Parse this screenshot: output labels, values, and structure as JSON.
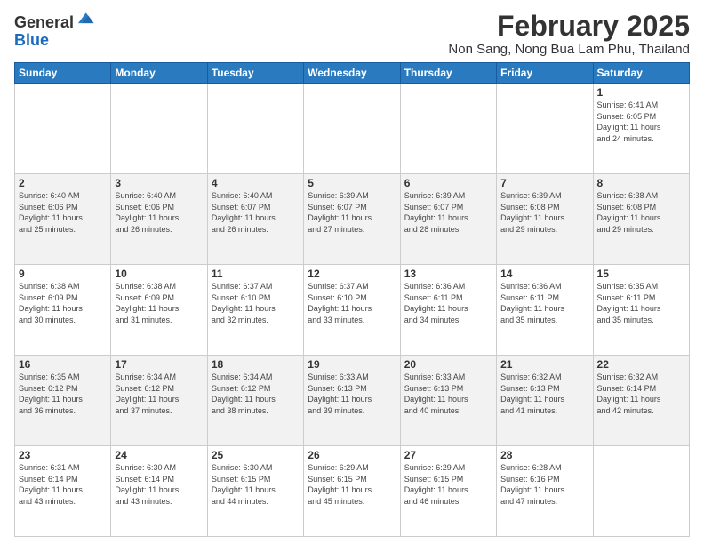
{
  "logo": {
    "general": "General",
    "blue": "Blue"
  },
  "header": {
    "month": "February 2025",
    "location": "Non Sang, Nong Bua Lam Phu, Thailand"
  },
  "weekdays": [
    "Sunday",
    "Monday",
    "Tuesday",
    "Wednesday",
    "Thursday",
    "Friday",
    "Saturday"
  ],
  "weeks": [
    [
      {
        "day": "",
        "info": ""
      },
      {
        "day": "",
        "info": ""
      },
      {
        "day": "",
        "info": ""
      },
      {
        "day": "",
        "info": ""
      },
      {
        "day": "",
        "info": ""
      },
      {
        "day": "",
        "info": ""
      },
      {
        "day": "1",
        "info": "Sunrise: 6:41 AM\nSunset: 6:05 PM\nDaylight: 11 hours\nand 24 minutes."
      }
    ],
    [
      {
        "day": "2",
        "info": "Sunrise: 6:40 AM\nSunset: 6:06 PM\nDaylight: 11 hours\nand 25 minutes."
      },
      {
        "day": "3",
        "info": "Sunrise: 6:40 AM\nSunset: 6:06 PM\nDaylight: 11 hours\nand 26 minutes."
      },
      {
        "day": "4",
        "info": "Sunrise: 6:40 AM\nSunset: 6:07 PM\nDaylight: 11 hours\nand 26 minutes."
      },
      {
        "day": "5",
        "info": "Sunrise: 6:39 AM\nSunset: 6:07 PM\nDaylight: 11 hours\nand 27 minutes."
      },
      {
        "day": "6",
        "info": "Sunrise: 6:39 AM\nSunset: 6:07 PM\nDaylight: 11 hours\nand 28 minutes."
      },
      {
        "day": "7",
        "info": "Sunrise: 6:39 AM\nSunset: 6:08 PM\nDaylight: 11 hours\nand 29 minutes."
      },
      {
        "day": "8",
        "info": "Sunrise: 6:38 AM\nSunset: 6:08 PM\nDaylight: 11 hours\nand 29 minutes."
      }
    ],
    [
      {
        "day": "9",
        "info": "Sunrise: 6:38 AM\nSunset: 6:09 PM\nDaylight: 11 hours\nand 30 minutes."
      },
      {
        "day": "10",
        "info": "Sunrise: 6:38 AM\nSunset: 6:09 PM\nDaylight: 11 hours\nand 31 minutes."
      },
      {
        "day": "11",
        "info": "Sunrise: 6:37 AM\nSunset: 6:10 PM\nDaylight: 11 hours\nand 32 minutes."
      },
      {
        "day": "12",
        "info": "Sunrise: 6:37 AM\nSunset: 6:10 PM\nDaylight: 11 hours\nand 33 minutes."
      },
      {
        "day": "13",
        "info": "Sunrise: 6:36 AM\nSunset: 6:11 PM\nDaylight: 11 hours\nand 34 minutes."
      },
      {
        "day": "14",
        "info": "Sunrise: 6:36 AM\nSunset: 6:11 PM\nDaylight: 11 hours\nand 35 minutes."
      },
      {
        "day": "15",
        "info": "Sunrise: 6:35 AM\nSunset: 6:11 PM\nDaylight: 11 hours\nand 35 minutes."
      }
    ],
    [
      {
        "day": "16",
        "info": "Sunrise: 6:35 AM\nSunset: 6:12 PM\nDaylight: 11 hours\nand 36 minutes."
      },
      {
        "day": "17",
        "info": "Sunrise: 6:34 AM\nSunset: 6:12 PM\nDaylight: 11 hours\nand 37 minutes."
      },
      {
        "day": "18",
        "info": "Sunrise: 6:34 AM\nSunset: 6:12 PM\nDaylight: 11 hours\nand 38 minutes."
      },
      {
        "day": "19",
        "info": "Sunrise: 6:33 AM\nSunset: 6:13 PM\nDaylight: 11 hours\nand 39 minutes."
      },
      {
        "day": "20",
        "info": "Sunrise: 6:33 AM\nSunset: 6:13 PM\nDaylight: 11 hours\nand 40 minutes."
      },
      {
        "day": "21",
        "info": "Sunrise: 6:32 AM\nSunset: 6:13 PM\nDaylight: 11 hours\nand 41 minutes."
      },
      {
        "day": "22",
        "info": "Sunrise: 6:32 AM\nSunset: 6:14 PM\nDaylight: 11 hours\nand 42 minutes."
      }
    ],
    [
      {
        "day": "23",
        "info": "Sunrise: 6:31 AM\nSunset: 6:14 PM\nDaylight: 11 hours\nand 43 minutes."
      },
      {
        "day": "24",
        "info": "Sunrise: 6:30 AM\nSunset: 6:14 PM\nDaylight: 11 hours\nand 43 minutes."
      },
      {
        "day": "25",
        "info": "Sunrise: 6:30 AM\nSunset: 6:15 PM\nDaylight: 11 hours\nand 44 minutes."
      },
      {
        "day": "26",
        "info": "Sunrise: 6:29 AM\nSunset: 6:15 PM\nDaylight: 11 hours\nand 45 minutes."
      },
      {
        "day": "27",
        "info": "Sunrise: 6:29 AM\nSunset: 6:15 PM\nDaylight: 11 hours\nand 46 minutes."
      },
      {
        "day": "28",
        "info": "Sunrise: 6:28 AM\nSunset: 6:16 PM\nDaylight: 11 hours\nand 47 minutes."
      },
      {
        "day": "",
        "info": ""
      }
    ]
  ]
}
